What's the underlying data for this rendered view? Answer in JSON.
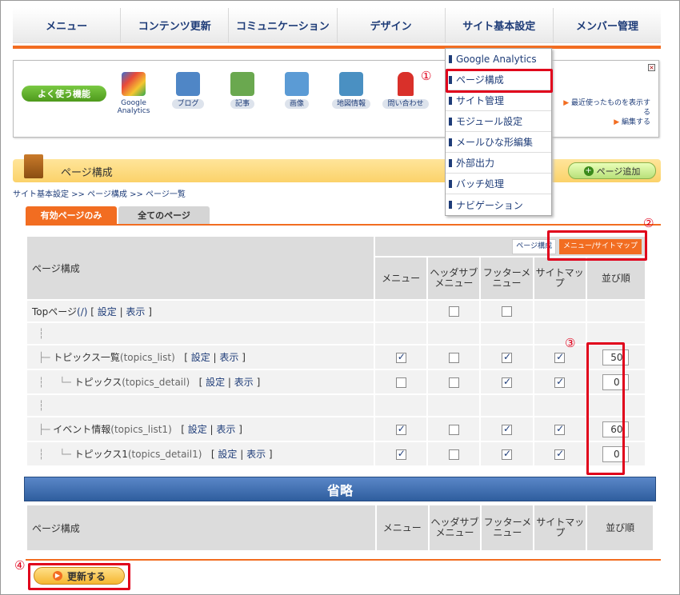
{
  "nav": [
    "メニュー",
    "コンテンツ更新",
    "コミュニケーション",
    "デザイン",
    "サイト基本設定",
    "メンバー管理"
  ],
  "favorites": {
    "label": "よく使う機能",
    "icons": [
      {
        "label": "Google Analytics",
        "icon": "google-analytics-icon",
        "color": "#3a6fd0"
      },
      {
        "label": "ブログ",
        "icon": "blog-icon",
        "color": "#4f86c6"
      },
      {
        "label": "記事",
        "icon": "article-icon",
        "color": "#6aa84f"
      },
      {
        "label": "画像",
        "icon": "image-icon",
        "color": "#5b9bd5"
      },
      {
        "label": "地図情報",
        "icon": "map-icon",
        "color": "#4a90c2"
      },
      {
        "label": "問い合わせ",
        "icon": "mailbox-icon",
        "color": "#d9302a"
      }
    ],
    "recent_line1": "最近使ったものを表示す",
    "recent_line2": "る",
    "recent_edit": "編集する"
  },
  "dropdown": [
    "Google Analytics",
    "ページ構成",
    "サイト管理",
    "モジュール設定",
    "メールひな形編集",
    "外部出力",
    "バッチ処理",
    "ナビゲーション"
  ],
  "callouts": [
    "①",
    "②",
    "③",
    "④"
  ],
  "page": {
    "title": "ページ構成",
    "add_button": "ページ追加",
    "breadcrumb": "サイト基本設定 >> ページ構成 >> ページ一覧"
  },
  "tabs": [
    "有効ページのみ",
    "全てのページ"
  ],
  "table": {
    "view_toggle": [
      "ページ構成",
      "メニュー/サイトマップ"
    ],
    "col_name": "ページ構成",
    "cols": [
      "メニュー",
      "ヘッダサブメニュー",
      "フッターメニュー",
      "サイトマップ",
      "並び順"
    ],
    "rows": [
      {
        "name": "Topページ",
        "slug": "(/)",
        "links": [
          "設定",
          "表示"
        ],
        "menu": null,
        "header": false,
        "footer": false,
        "sitemap": null,
        "order": null
      },
      {
        "name": "トピックス一覧",
        "slug": "(topics_list)",
        "links": [
          "設定",
          "表示"
        ],
        "menu": true,
        "header": false,
        "footer": true,
        "sitemap": true,
        "order": "50"
      },
      {
        "name": "トピックス",
        "slug": "(topics_detail)",
        "links": [
          "設定",
          "表示"
        ],
        "menu": false,
        "header": false,
        "footer": true,
        "sitemap": true,
        "order": "0"
      },
      {
        "name": "イベント情報",
        "slug": "(topics_list1)",
        "links": [
          "設定",
          "表示"
        ],
        "menu": true,
        "header": false,
        "footer": true,
        "sitemap": true,
        "order": "60"
      },
      {
        "name": "トピックス1",
        "slug": "(topics_detail1)",
        "links": [
          "設定",
          "表示"
        ],
        "menu": true,
        "header": false,
        "footer": true,
        "sitemap": true,
        "order": "0"
      }
    ]
  },
  "omit_label": "省略",
  "update_button": "更新する"
}
